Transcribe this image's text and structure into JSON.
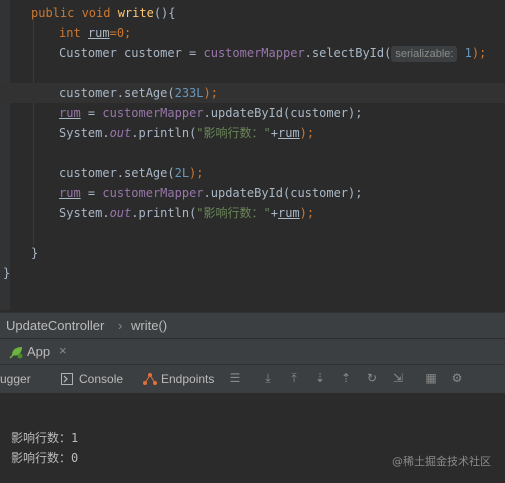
{
  "editor": {
    "line1": {
      "kw": "public void ",
      "method": "write",
      "rest": "(){"
    },
    "line2": {
      "kw": "int ",
      "var": "rum",
      "rest": "=0;"
    },
    "line3": {
      "type": "Customer customer = ",
      "mapper": "customerMapper",
      "call": ".selectById(",
      "hint": "serializable:",
      "num": " 1",
      "end": ");"
    },
    "line4": {
      "obj": "customer.setAge(",
      "num": "233L",
      "end": ");"
    },
    "line5": {
      "var": "rum",
      "eq": " = ",
      "mapper": "customerMapper",
      "call": ".updateById(customer);"
    },
    "line6": {
      "sys": "System.",
      "out": "out",
      "call": ".println(",
      "str": "\"影响行数：\"",
      "plus": "+",
      "var": "rum",
      "end": ");"
    },
    "line7": {
      "obj": "customer.setAge(",
      "num": "2L",
      "end": ");"
    },
    "line8": {
      "var": "rum",
      "eq": " = ",
      "mapper": "customerMapper",
      "call": ".updateById(customer);"
    },
    "line9": {
      "sys": "System.",
      "out": "out",
      "call": ".println(",
      "str": "\"影响行数：\"",
      "plus": "+",
      "var": "rum",
      "end": ");"
    },
    "close_method": "}",
    "close_class": "}"
  },
  "breadcrumb": {
    "class": "UpdateController",
    "separator": "›",
    "method": "write()"
  },
  "run": {
    "tab_label": "App",
    "close": "×"
  },
  "toolbar": {
    "debugger": "ugger",
    "console": "Console",
    "endpoints": "Endpoints"
  },
  "console": {
    "line1": "影响行数：1",
    "line2": "影响行数：0"
  },
  "watermark": "@稀土掘金技术社区"
}
